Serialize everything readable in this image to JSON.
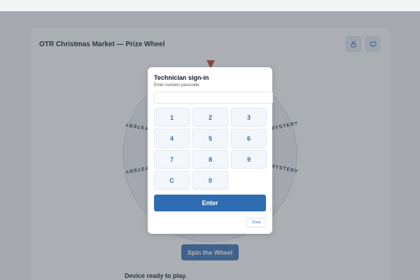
{
  "app": {
    "title": "OTR Christmas Market — Prize Wheel",
    "lock_icon": "lock-icon",
    "display_icon": "monitor-icon"
  },
  "wheel": {
    "labels": [
      "MYSTERY",
      "MYSTERY",
      "MYSTERY",
      "MYSTERY"
    ],
    "pointer_color": "#c0392b"
  },
  "spin_button": {
    "label": "Spin the Wheel"
  },
  "status": {
    "text": "Device ready to play."
  },
  "modal": {
    "title": "Technician sign-in",
    "subtitle": "Enter numeric passcode",
    "passcode_value": "",
    "keys": [
      "1",
      "2",
      "3",
      "4",
      "5",
      "6",
      "7",
      "8",
      "9",
      "C",
      "0"
    ],
    "enter_label": "Enter",
    "close_label": "Close"
  },
  "colors": {
    "accent": "#2f6db3",
    "key_text": "#2e6db5",
    "overlay": "#50565f"
  }
}
